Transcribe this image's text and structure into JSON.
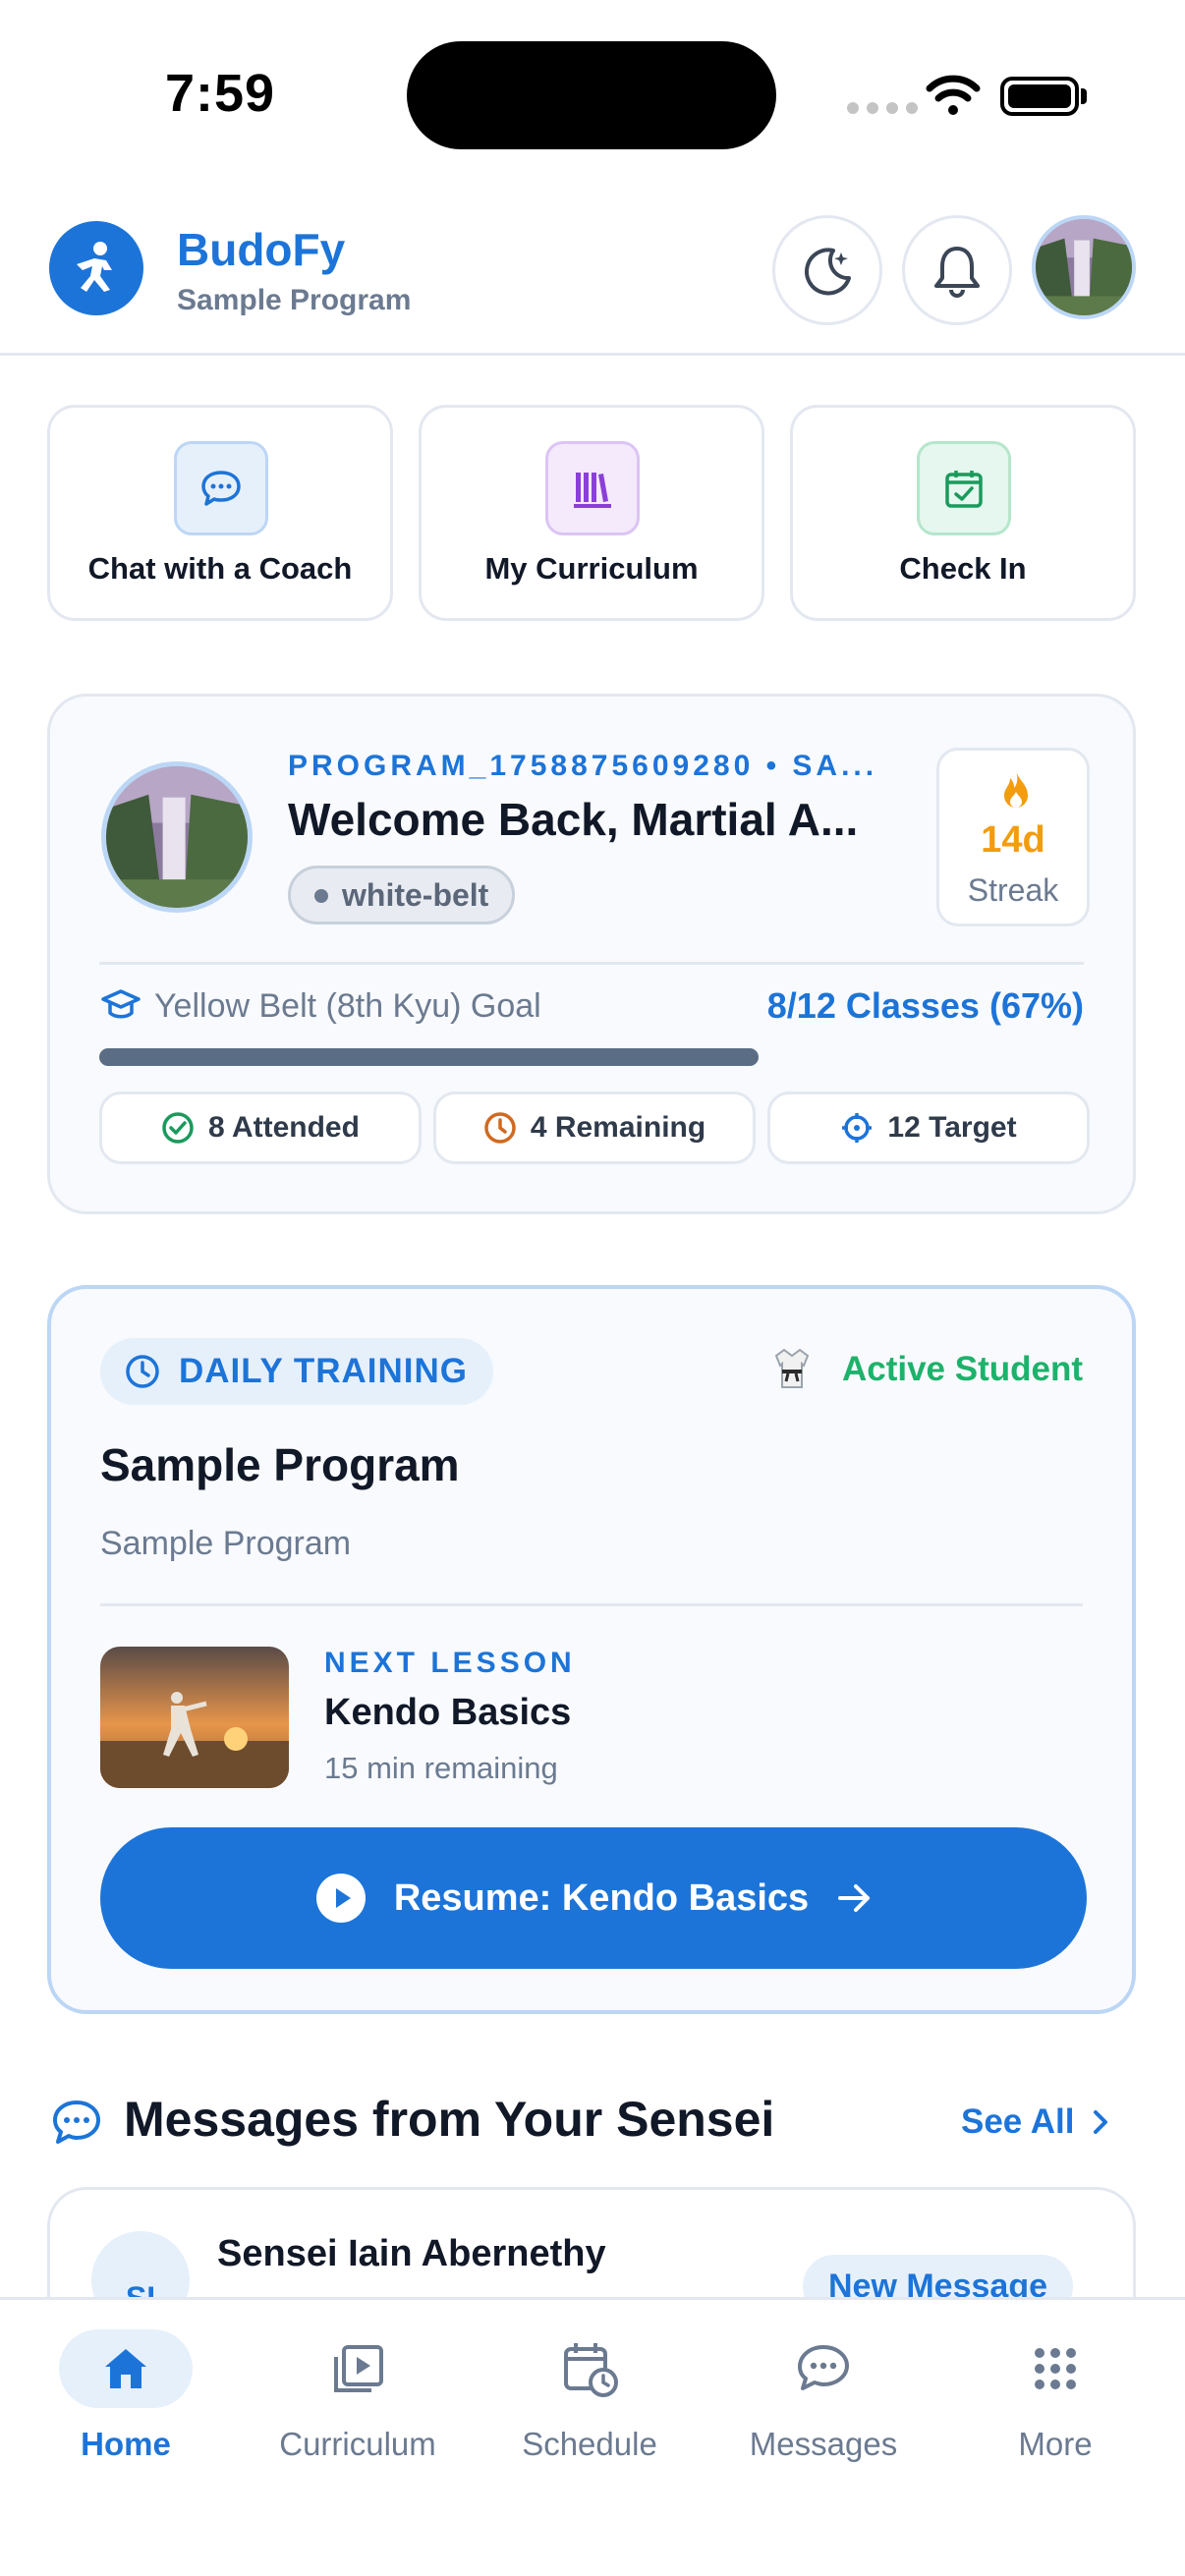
{
  "status_bar": {
    "time": "7:59"
  },
  "header": {
    "app_title": "BudoFy",
    "app_subtitle": "Sample Program"
  },
  "quick_actions": [
    {
      "label": "Chat with a Coach",
      "icon": "chat-bubble-icon",
      "color": "#1d74d8"
    },
    {
      "label": "My Curriculum",
      "icon": "books-icon",
      "color": "#8b3fd9"
    },
    {
      "label": "Check In",
      "icon": "calendar-check-icon",
      "color": "#1a9a5c"
    }
  ],
  "progress": {
    "program_id": "PROGRAM_1758875609280 • SA...",
    "welcome": "Welcome Back, Martial A...",
    "belt": "white-belt",
    "streak_value": "14d",
    "streak_label": "Streak",
    "goal_label": "Yellow Belt (8th Kyu) Goal",
    "goal_value": "8/12 Classes (67%)",
    "goal_fraction": 0.67,
    "stats": {
      "attended": "8 Attended",
      "remaining": "4 Remaining",
      "target": "12 Target"
    }
  },
  "training": {
    "badge": "DAILY TRAINING",
    "status": "Active Student",
    "title": "Sample Program",
    "subtitle": "Sample Program",
    "next_label": "NEXT LESSON",
    "next_title": "Kendo Basics",
    "next_sub": "15 min remaining",
    "resume_label": "Resume: Kendo Basics"
  },
  "messages": {
    "heading": "Messages from Your Sensei",
    "see_all": "See All",
    "items": [
      {
        "initials": "SI",
        "sender": "Sensei Iain Abernethy",
        "tag": "New Message"
      }
    ]
  },
  "tab_bar": [
    {
      "label": "Home",
      "icon": "home-icon",
      "active": true
    },
    {
      "label": "Curriculum",
      "icon": "video-library-icon",
      "active": false
    },
    {
      "label": "Schedule",
      "icon": "calendar-clock-icon",
      "active": false
    },
    {
      "label": "Messages",
      "icon": "chat-bubble-icon",
      "active": false
    },
    {
      "label": "More",
      "icon": "grid-dots-icon",
      "active": false
    }
  ],
  "colors": {
    "accent": "#1d74d8",
    "success": "#1db26b",
    "streak": "#f39c0e"
  }
}
